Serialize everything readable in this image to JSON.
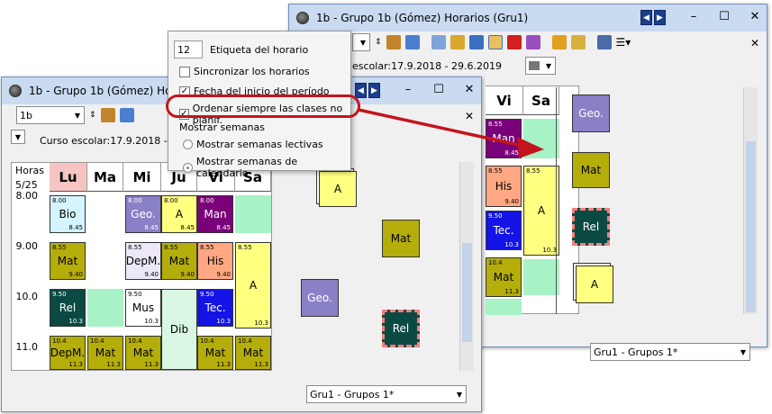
{
  "back_window": {
    "title": "1b - Grupo 1b (Gómez)  Horarios  (Gru1)",
    "school_year": "escolar:17.9.2018 - 29.6.2019",
    "day_headers": [
      "Vi",
      "Sa"
    ],
    "cells": [
      {
        "start": "8.55",
        "end": "8.45",
        "label": "Man"
      },
      {
        "start": "8.55",
        "end": "9.40",
        "label": "His"
      },
      {
        "start": "8.55",
        "end": "10.3",
        "label": "A"
      },
      {
        "start": "9.50",
        "end": "10.3",
        "label": "Tec."
      },
      {
        "start": "10.4",
        "end": "11.3",
        "label": "Mat"
      }
    ],
    "cards": [
      "Geo.",
      "Mat",
      "Rel",
      "A"
    ],
    "class_select": "Gru1 - Grupos 1*"
  },
  "front_window": {
    "title": "1b - Grupo 1b (Gómez)  Horari",
    "class_combo": "1b",
    "school_year": "Curso escolar:17.9.2018 - 29.6.2019",
    "hours_label": "Horas",
    "hours_count": "5/25",
    "day_headers": [
      "Lu",
      "Ma",
      "Mi",
      "Ju",
      "Vi",
      "Sa"
    ],
    "times": [
      "8.00",
      "9.00",
      "10.0",
      "11.0"
    ],
    "cells": [
      {
        "start": "8.00",
        "end": "8.45",
        "label": "Bio"
      },
      {
        "start": "8.00",
        "end": "8.45",
        "label": "Geo."
      },
      {
        "start": "8.00",
        "end": "8.45",
        "label": "A"
      },
      {
        "start": "8.00",
        "end": "8.45",
        "label": "Man"
      },
      {
        "start": "8.55",
        "end": "9.40",
        "label": "Mat"
      },
      {
        "start": "8.55",
        "end": "9.40",
        "label": "DepM."
      },
      {
        "start": "8.55",
        "end": "9.40",
        "label": "Mat"
      },
      {
        "start": "8.55",
        "end": "9.40",
        "label": "His"
      },
      {
        "start": "8.55",
        "end": "10.3",
        "label": "A"
      },
      {
        "start": "9.50",
        "end": "10.3",
        "label": "Rel"
      },
      {
        "start": "9.50",
        "end": "10.3",
        "label": "Mus"
      },
      {
        "start": "",
        "end": "",
        "label": "Dib"
      },
      {
        "start": "9.50",
        "end": "10.3",
        "label": "Tec."
      },
      {
        "start": "10.4",
        "end": "11.3",
        "label": "DepM."
      },
      {
        "start": "10.4",
        "end": "11.3",
        "label": "Mat"
      },
      {
        "start": "10.4",
        "end": "11.3",
        "label": "Mat"
      },
      {
        "start": "10.4",
        "end": "11.3",
        "label": "Mat"
      },
      {
        "start": "10.4",
        "end": "11.3",
        "label": "Mat"
      }
    ],
    "cards": [
      "A",
      "Mat",
      "Geo.",
      "Rel"
    ],
    "class_select": "Gru1 - Grupos 1*"
  },
  "popup": {
    "label_value": "12",
    "label_text": "Etiqueta del horario",
    "sync": "Sincronizar los horarios",
    "start_date": "Fecha del inicio del período",
    "sort_unplanned": "Ordenar siempre las clases no planif.",
    "weeks_header": "Mostrar semanas",
    "teaching_weeks": "Mostrar semanas lectivas",
    "calendar_weeks": "Mostrar semanas de calendario"
  },
  "colors": {
    "highlight": "#c4151c",
    "titlebar": "#c9daf1",
    "mat": "#b4ad0a",
    "rel": "#0b4a43",
    "geo": "#8a80c6",
    "a": "#ffff80",
    "man": "#7a007a",
    "tec": "#1414e6",
    "his": "#ffa883",
    "bio": "#d4f4ff",
    "green": "#a7f2c6"
  }
}
